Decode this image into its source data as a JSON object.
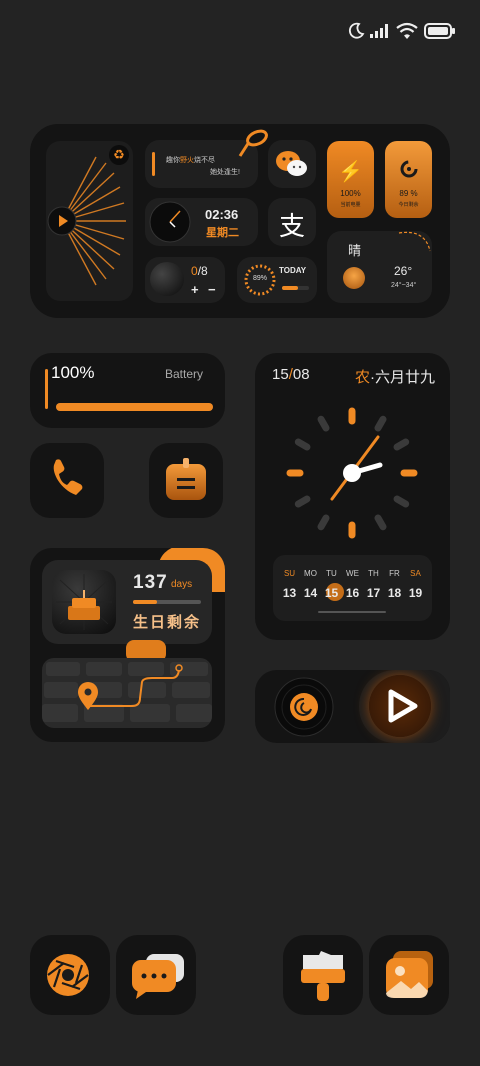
{
  "colors": {
    "accent": "#f08a24",
    "background": "#232323",
    "card": "#141414"
  },
  "status_bar": {
    "icons": [
      "moon-icon",
      "signal-icon",
      "wifi-icon",
      "battery-icon"
    ]
  },
  "top_widget": {
    "recycle_icon": "recycle-icon",
    "quote": {
      "line1_a": "趣你",
      "line1_b": "野火",
      "line1_c": "烧不尽",
      "line2": "她处逢生!"
    },
    "clock": {
      "time": "02:36",
      "weekday": "星期二"
    },
    "steps": {
      "value": "0",
      "separator": "/",
      "target": "8",
      "plus": "+",
      "minus": "−"
    },
    "today": {
      "percent": "89%",
      "label": "TODAY",
      "progress": 0.6
    },
    "power": {
      "percent": "100%",
      "label": "当前电量"
    },
    "storage": {
      "percent": "89 %",
      "label": "今日剩余"
    },
    "weather": {
      "condition": "晴",
      "temp": "26°",
      "range": "24°~34°"
    }
  },
  "battery_widget": {
    "percent": "100%",
    "label": "Battery",
    "level": 1.0
  },
  "calendar_widget": {
    "date_day": "15",
    "date_slash": "/",
    "date_month": "08",
    "lunar_prefix": "农",
    "lunar_dot": "·",
    "lunar_date": "六月廿九",
    "weekdays": [
      "SU",
      "MO",
      "TU",
      "WE",
      "TH",
      "FR",
      "SA"
    ],
    "days": [
      "13",
      "14",
      "15",
      "16",
      "17",
      "18",
      "19"
    ],
    "today_index": 2
  },
  "countdown_widget": {
    "number": "137",
    "unit": "days",
    "label": "生日剩余",
    "progress": 0.35
  },
  "apps": {
    "phone": "phone-icon",
    "calendar": "calendar-app-icon",
    "camera": "camera-aperture-icon",
    "messages": "messages-icon",
    "brush": "theme-brush-icon",
    "gallery": "gallery-icon"
  },
  "music_widget": {
    "vinyl": "vinyl-icon",
    "play": "play-icon"
  }
}
